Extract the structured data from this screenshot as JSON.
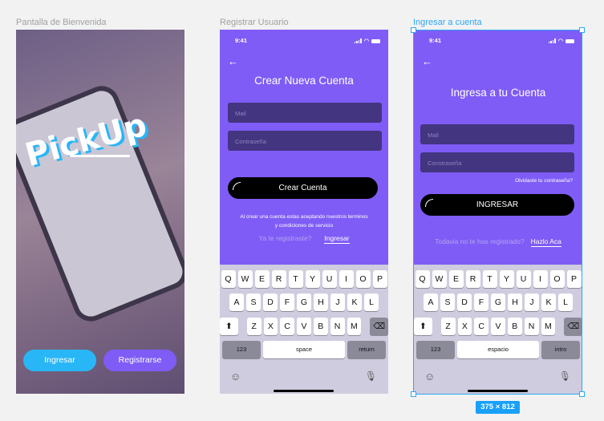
{
  "frames": {
    "welcome": "Pantalla de Bienvenida",
    "register": "Registrar Usuario",
    "login": "Ingresar a cuenta"
  },
  "status_time": "9:41",
  "welcome": {
    "logo": "PickUp",
    "login_button": "Ingresar",
    "register_button": "Registrarse",
    "login_color": "#29b6f6",
    "register_color": "#7f5cf6"
  },
  "register": {
    "title": "Crear Nueva Cuenta",
    "mail_placeholder": "Mail",
    "password_placeholder": "Contraseña",
    "submit": "Crear Cuenta",
    "terms_line1": "Al crear una cuenta estas aceptando nuestros terminos",
    "terms_line2": "y condiciones de servicio",
    "already": "Ya te registraste?",
    "login_link": "Ingresar"
  },
  "login": {
    "title": "Ingresa a tu Cuenta",
    "mail_placeholder": "Mail",
    "password_placeholder": "Constraseña",
    "forgot": "Olvidaste tu contraseña?",
    "submit": "INGRESAR",
    "not_registered": "Todavia no te has registrado?",
    "signup_link": "Hazlo Aca"
  },
  "keyboard": {
    "row1": [
      "Q",
      "W",
      "E",
      "R",
      "T",
      "Y",
      "U",
      "I",
      "O",
      "P"
    ],
    "row2": [
      "A",
      "S",
      "D",
      "F",
      "G",
      "H",
      "J",
      "K",
      "L"
    ],
    "row3": [
      "Z",
      "X",
      "C",
      "V",
      "B",
      "N",
      "M"
    ],
    "numbers": "123",
    "register_space": "space",
    "register_return": "return",
    "login_space": "espacio",
    "login_return": "intro"
  },
  "selection_size": "375 × 812",
  "accent": "#7f5cf6"
}
